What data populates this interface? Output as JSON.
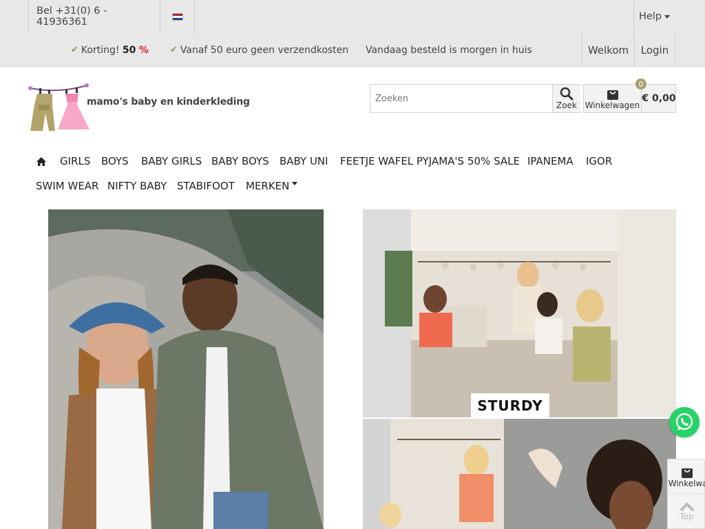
{
  "topbar": {
    "phone": "Bel +31(0) 6 - 41936361",
    "help": "Help",
    "usps": [
      {
        "prefix": "Korting! ",
        "highlight": "50",
        "highlight_suffix": " %"
      },
      {
        "text": "Vanaf 50 euro geen verzendkosten"
      },
      {
        "text": "Vandaag besteld is morgen in huis"
      }
    ],
    "welkom": "Welkom",
    "login": "Login",
    "flag_colors": [
      "#ae1c28",
      "#ffffff",
      "#21468b"
    ]
  },
  "header": {
    "logo_text": "mamo's baby en kinderkleding",
    "search_placeholder": "Zoeken",
    "search_button": "Zoek",
    "cart_label": "Winkelwagen",
    "cart_count": "0",
    "cart_total": "€ 0,00"
  },
  "nav": {
    "items": [
      "GIRLS",
      "BOYS",
      "BABY GIRLS",
      "BABY BOYS",
      "BABY UNI",
      "FEETJE WAFEL PYJAMA'S",
      "50% SALE",
      "IPANEMA",
      "IGOR",
      "SWIM WEAR",
      "NIFTY BABY",
      "STABIFOOT",
      "MERKEN"
    ]
  },
  "banners": {
    "sturdy": "STURDY"
  },
  "float": {
    "cart_label": "Winkelwagen",
    "top_label": "Top"
  },
  "colors": {
    "accent": "#8a9a5b",
    "sale_red": "#e3221b",
    "whatsapp": "#25d366"
  }
}
